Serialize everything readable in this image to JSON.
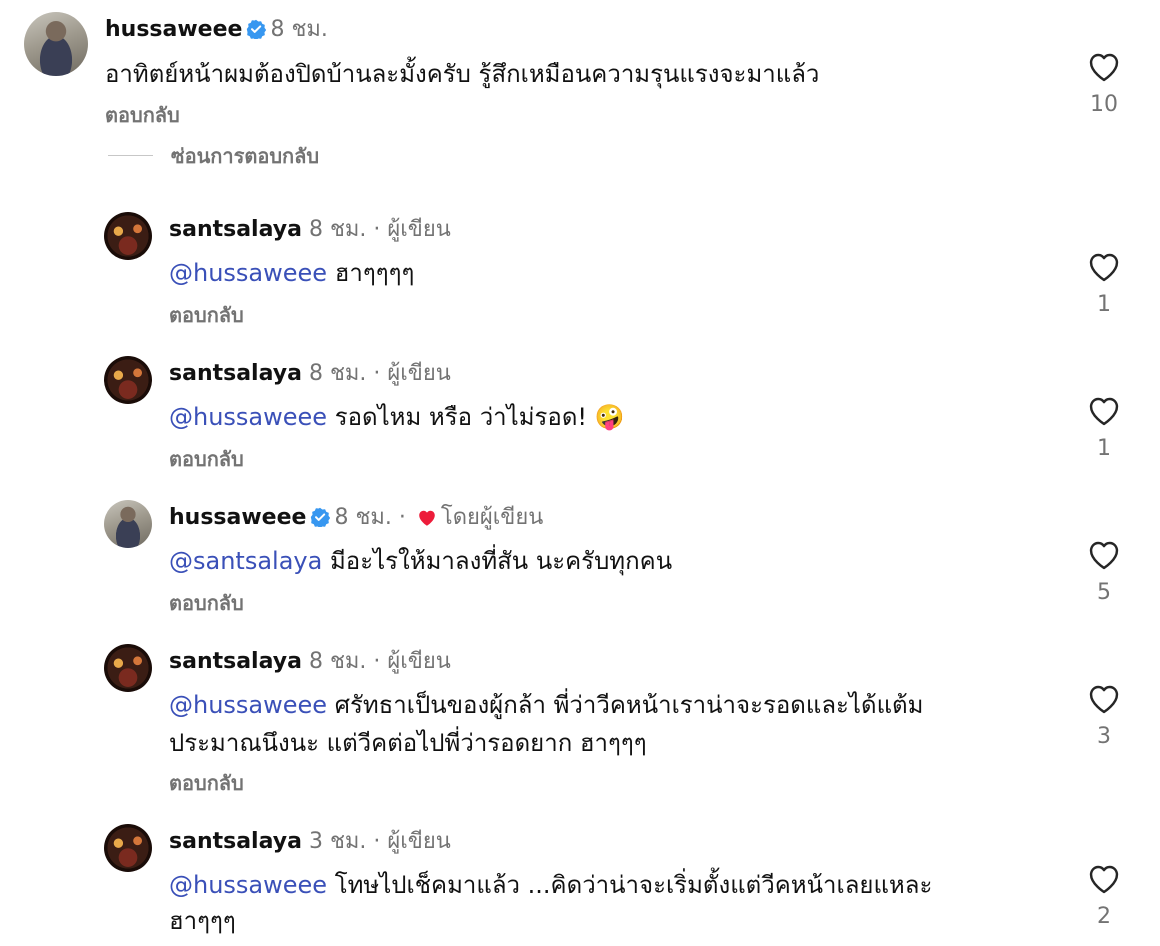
{
  "comments": [
    {
      "username": "hussaweee",
      "verified": true,
      "time": "8 ชม.",
      "badge": "",
      "mention": "",
      "text_lines": [
        "อาทิตย์หน้าผมต้องปิดบ้านละมั้งครับ รู้สึกเหมือนความรุนแรงจะมาแล้ว"
      ],
      "reply_label": "ตอบกลับ",
      "likes": "10"
    }
  ],
  "hide_replies_label": "ซ่อนการตอบกลับ",
  "replies": [
    {
      "username": "santsalaya",
      "time": "8 ชม.",
      "badge": "· ผู้เขียน",
      "mention": "@hussaweee",
      "text_lines": [
        "ฮาๆๆๆๆ"
      ],
      "reply_label": "ตอบกลับ",
      "likes": "1"
    },
    {
      "username": "santsalaya",
      "time": "8 ชม.",
      "badge": "· ผู้เขียน",
      "mention": "@hussaweee",
      "text_lines": [
        "รอดไหม หรือ ว่าไม่รอด! 🤪"
      ],
      "reply_label": "ตอบกลับ",
      "likes": "1"
    },
    {
      "username": "hussaweee",
      "verified": true,
      "time": "8 ชม.",
      "badge": "โดยผู้เขียน",
      "liked_by_author": true,
      "mention": "@santsalaya",
      "text_lines": [
        "มีอะไรให้มาลงที่สัน นะครับทุกคน"
      ],
      "reply_label": "ตอบกลับ",
      "likes": "5"
    },
    {
      "username": "santsalaya",
      "time": "8 ชม.",
      "badge": "· ผู้เขียน",
      "mention": "@hussaweee",
      "text_lines": [
        "ศรัทธาเป็นของผู้กล้า พี่ว่าวีคหน้าเราน่าจะรอดและได้แต้ม",
        "ประมาณนึงนะ แต่วีคต่อไปพี่ว่ารอดยาก ฮาๆๆๆ"
      ],
      "reply_label": "ตอบกลับ",
      "likes": "3"
    },
    {
      "username": "santsalaya",
      "time": "3 ชม.",
      "badge": "· ผู้เขียน",
      "mention": "@hussaweee",
      "text_lines": [
        "โทษไปเช็คมาแล้ว ...คิดว่าน่าจะเริ่มตั้งแต่วีคหน้าเลยแหละ",
        "ฮาๆๆๆ"
      ],
      "reply_label": "",
      "likes": "2"
    }
  ],
  "colors": {
    "mention": "#3a50b8",
    "meta": "#737373",
    "verified": "#3797f0",
    "heart": "#ed1c3a"
  },
  "icons": {
    "like": "heart-outline-icon",
    "verified": "verified-badge-icon",
    "liked_by_author": "heart-filled-icon"
  }
}
